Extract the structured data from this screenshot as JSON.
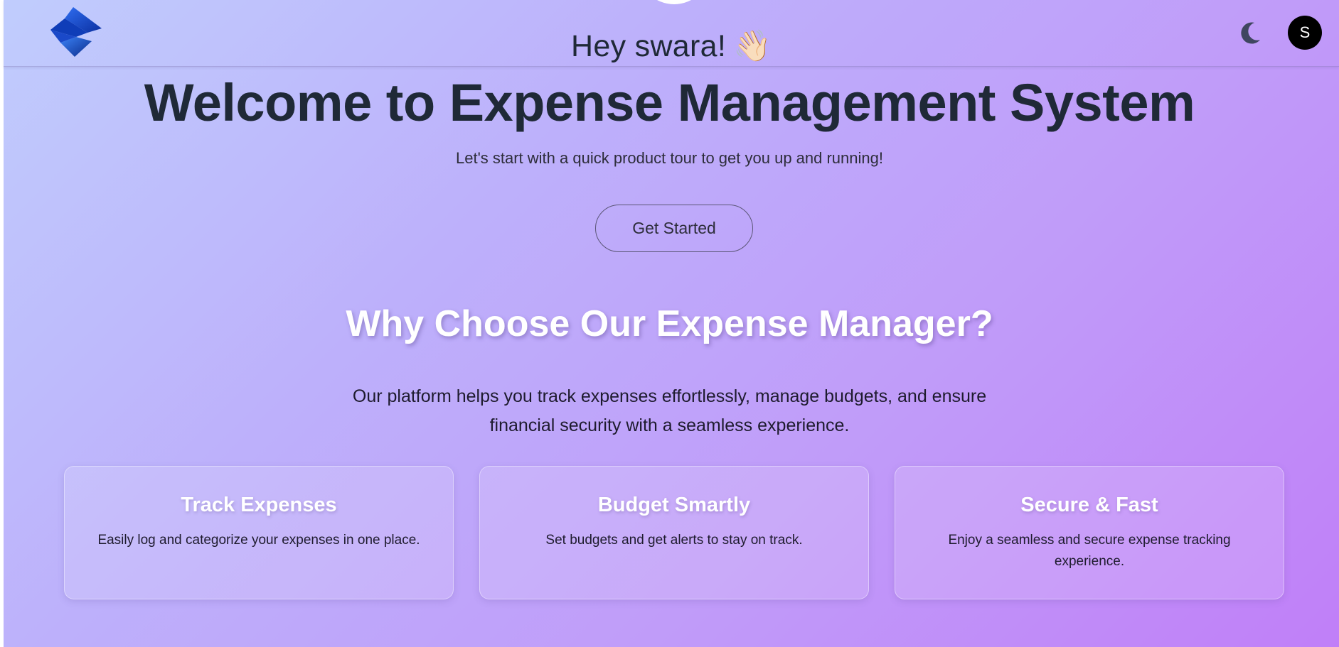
{
  "header": {
    "greeting": "Hey swara!",
    "greeting_emoji": "👋🏻",
    "logo_icon": "stacked-diamond-logo",
    "theme_toggle_icon": "moon-icon",
    "avatar_initial": "S"
  },
  "hero": {
    "title": "Welcome to Expense Management System",
    "subtitle": "Let's start with a quick product tour to get you up and running!",
    "cta_label": "Get Started"
  },
  "why": {
    "title": "Why Choose Our Expense Manager?",
    "description": "Our platform helps you track expenses effortlessly, manage budgets, and ensure financial security with a seamless experience."
  },
  "features": [
    {
      "title": "Track Expenses",
      "text": "Easily log and categorize your expenses in one place."
    },
    {
      "title": "Budget Smartly",
      "text": "Set budgets and get alerts to stay on track."
    },
    {
      "title": "Secure & Fast",
      "text": "Enjoy a seamless and secure expense tracking experience."
    }
  ],
  "colors": {
    "heading_dark": "#1f2937",
    "avatar_bg": "#000000",
    "logo_blue": "#1d4ed8",
    "moon": "#3f4660",
    "gradient_start": "#c0cdfd",
    "gradient_end": "#c07ff8"
  }
}
